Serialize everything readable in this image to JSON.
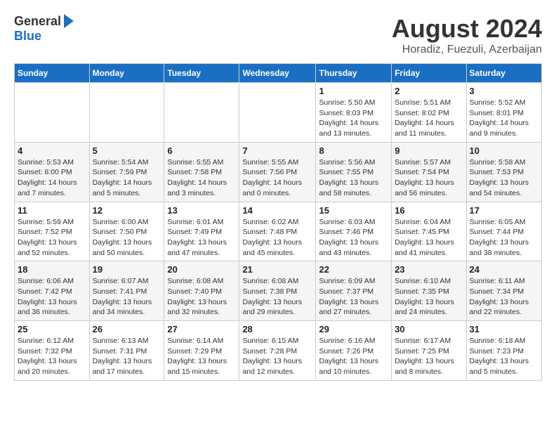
{
  "header": {
    "logo_general": "General",
    "logo_blue": "Blue",
    "month_title": "August 2024",
    "subtitle": "Horadiz, Fuezuli, Azerbaijan"
  },
  "weekdays": [
    "Sunday",
    "Monday",
    "Tuesday",
    "Wednesday",
    "Thursday",
    "Friday",
    "Saturday"
  ],
  "weeks": [
    [
      {
        "day": "",
        "content": ""
      },
      {
        "day": "",
        "content": ""
      },
      {
        "day": "",
        "content": ""
      },
      {
        "day": "",
        "content": ""
      },
      {
        "day": "1",
        "content": "Sunrise: 5:50 AM\nSunset: 8:03 PM\nDaylight: 14 hours\nand 13 minutes."
      },
      {
        "day": "2",
        "content": "Sunrise: 5:51 AM\nSunset: 8:02 PM\nDaylight: 14 hours\nand 11 minutes."
      },
      {
        "day": "3",
        "content": "Sunrise: 5:52 AM\nSunset: 8:01 PM\nDaylight: 14 hours\nand 9 minutes."
      }
    ],
    [
      {
        "day": "4",
        "content": "Sunrise: 5:53 AM\nSunset: 8:00 PM\nDaylight: 14 hours\nand 7 minutes."
      },
      {
        "day": "5",
        "content": "Sunrise: 5:54 AM\nSunset: 7:59 PM\nDaylight: 14 hours\nand 5 minutes."
      },
      {
        "day": "6",
        "content": "Sunrise: 5:55 AM\nSunset: 7:58 PM\nDaylight: 14 hours\nand 3 minutes."
      },
      {
        "day": "7",
        "content": "Sunrise: 5:55 AM\nSunset: 7:56 PM\nDaylight: 14 hours\nand 0 minutes."
      },
      {
        "day": "8",
        "content": "Sunrise: 5:56 AM\nSunset: 7:55 PM\nDaylight: 13 hours\nand 58 minutes."
      },
      {
        "day": "9",
        "content": "Sunrise: 5:57 AM\nSunset: 7:54 PM\nDaylight: 13 hours\nand 56 minutes."
      },
      {
        "day": "10",
        "content": "Sunrise: 5:58 AM\nSunset: 7:53 PM\nDaylight: 13 hours\nand 54 minutes."
      }
    ],
    [
      {
        "day": "11",
        "content": "Sunrise: 5:59 AM\nSunset: 7:52 PM\nDaylight: 13 hours\nand 52 minutes."
      },
      {
        "day": "12",
        "content": "Sunrise: 6:00 AM\nSunset: 7:50 PM\nDaylight: 13 hours\nand 50 minutes."
      },
      {
        "day": "13",
        "content": "Sunrise: 6:01 AM\nSunset: 7:49 PM\nDaylight: 13 hours\nand 47 minutes."
      },
      {
        "day": "14",
        "content": "Sunrise: 6:02 AM\nSunset: 7:48 PM\nDaylight: 13 hours\nand 45 minutes."
      },
      {
        "day": "15",
        "content": "Sunrise: 6:03 AM\nSunset: 7:46 PM\nDaylight: 13 hours\nand 43 minutes."
      },
      {
        "day": "16",
        "content": "Sunrise: 6:04 AM\nSunset: 7:45 PM\nDaylight: 13 hours\nand 41 minutes."
      },
      {
        "day": "17",
        "content": "Sunrise: 6:05 AM\nSunset: 7:44 PM\nDaylight: 13 hours\nand 38 minutes."
      }
    ],
    [
      {
        "day": "18",
        "content": "Sunrise: 6:06 AM\nSunset: 7:42 PM\nDaylight: 13 hours\nand 36 minutes."
      },
      {
        "day": "19",
        "content": "Sunrise: 6:07 AM\nSunset: 7:41 PM\nDaylight: 13 hours\nand 34 minutes."
      },
      {
        "day": "20",
        "content": "Sunrise: 6:08 AM\nSunset: 7:40 PM\nDaylight: 13 hours\nand 32 minutes."
      },
      {
        "day": "21",
        "content": "Sunrise: 6:08 AM\nSunset: 7:38 PM\nDaylight: 13 hours\nand 29 minutes."
      },
      {
        "day": "22",
        "content": "Sunrise: 6:09 AM\nSunset: 7:37 PM\nDaylight: 13 hours\nand 27 minutes."
      },
      {
        "day": "23",
        "content": "Sunrise: 6:10 AM\nSunset: 7:35 PM\nDaylight: 13 hours\nand 24 minutes."
      },
      {
        "day": "24",
        "content": "Sunrise: 6:11 AM\nSunset: 7:34 PM\nDaylight: 13 hours\nand 22 minutes."
      }
    ],
    [
      {
        "day": "25",
        "content": "Sunrise: 6:12 AM\nSunset: 7:32 PM\nDaylight: 13 hours\nand 20 minutes."
      },
      {
        "day": "26",
        "content": "Sunrise: 6:13 AM\nSunset: 7:31 PM\nDaylight: 13 hours\nand 17 minutes."
      },
      {
        "day": "27",
        "content": "Sunrise: 6:14 AM\nSunset: 7:29 PM\nDaylight: 13 hours\nand 15 minutes."
      },
      {
        "day": "28",
        "content": "Sunrise: 6:15 AM\nSunset: 7:28 PM\nDaylight: 13 hours\nand 12 minutes."
      },
      {
        "day": "29",
        "content": "Sunrise: 6:16 AM\nSunset: 7:26 PM\nDaylight: 13 hours\nand 10 minutes."
      },
      {
        "day": "30",
        "content": "Sunrise: 6:17 AM\nSunset: 7:25 PM\nDaylight: 13 hours\nand 8 minutes."
      },
      {
        "day": "31",
        "content": "Sunrise: 6:18 AM\nSunset: 7:23 PM\nDaylight: 13 hours\nand 5 minutes."
      }
    ]
  ]
}
